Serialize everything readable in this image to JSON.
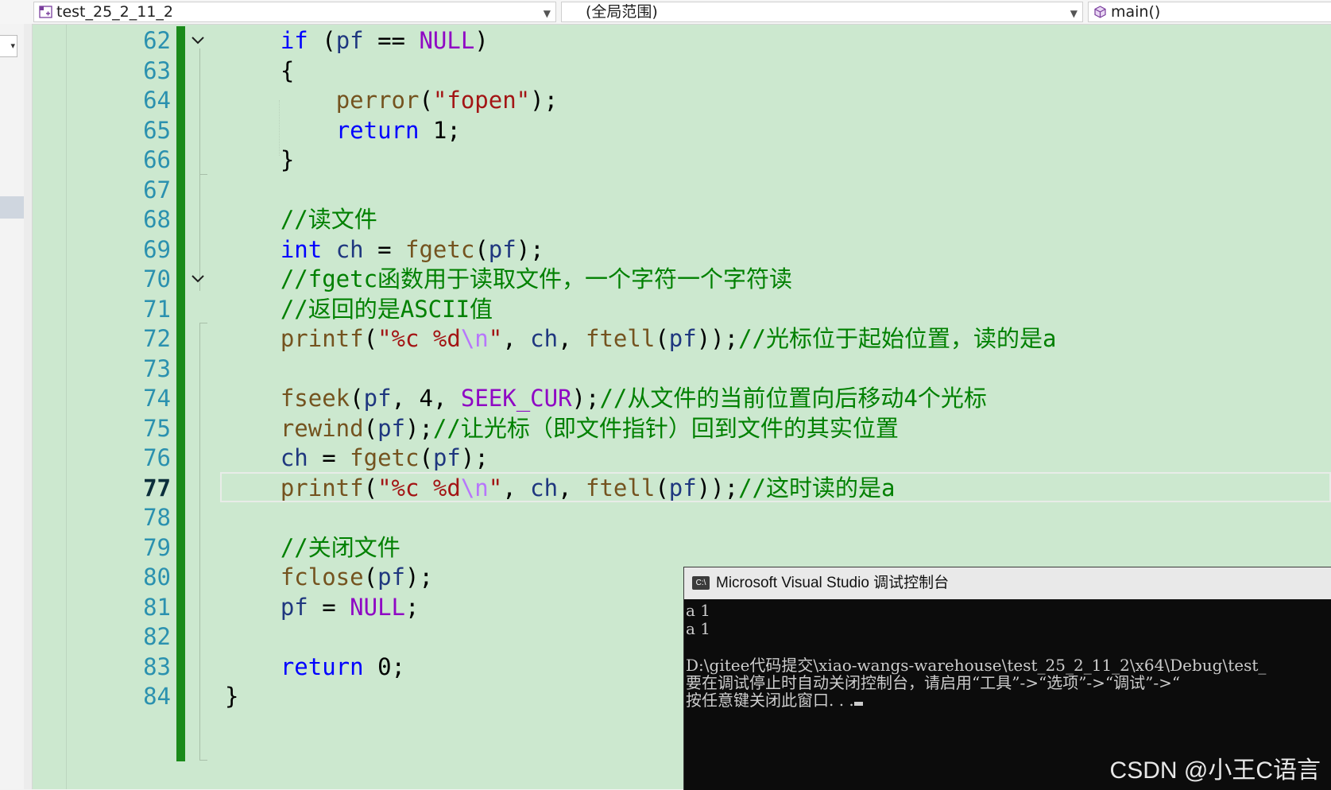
{
  "navbar": {
    "project": "test_25_2_11_2",
    "scope": "(全局范围)",
    "function": "main()"
  },
  "editor": {
    "current_line": 77,
    "lines": [
      {
        "n": "62",
        "tokens": [
          {
            "t": "    "
          },
          {
            "t": "if",
            "c": "kw"
          },
          {
            "t": " ("
          },
          {
            "t": "pf",
            "c": "var"
          },
          {
            "t": " == "
          },
          {
            "t": "NULL",
            "c": "mac"
          },
          {
            "t": ")"
          }
        ]
      },
      {
        "n": "63",
        "tokens": [
          {
            "t": "    {"
          }
        ]
      },
      {
        "n": "64",
        "tokens": [
          {
            "t": "        "
          },
          {
            "t": "perror",
            "c": "fn"
          },
          {
            "t": "("
          },
          {
            "t": "\"fopen\"",
            "c": "str"
          },
          {
            "t": ");"
          }
        ]
      },
      {
        "n": "65",
        "tokens": [
          {
            "t": "        "
          },
          {
            "t": "return",
            "c": "kw"
          },
          {
            "t": " "
          },
          {
            "t": "1",
            "c": "num"
          },
          {
            "t": ";"
          }
        ]
      },
      {
        "n": "66",
        "tokens": [
          {
            "t": "    }"
          }
        ]
      },
      {
        "n": "67",
        "tokens": []
      },
      {
        "n": "68",
        "tokens": [
          {
            "t": "    "
          },
          {
            "t": "//读文件",
            "c": "cm"
          }
        ]
      },
      {
        "n": "69",
        "tokens": [
          {
            "t": "    "
          },
          {
            "t": "int",
            "c": "kw"
          },
          {
            "t": " "
          },
          {
            "t": "ch",
            "c": "var"
          },
          {
            "t": " = "
          },
          {
            "t": "fgetc",
            "c": "fn"
          },
          {
            "t": "("
          },
          {
            "t": "pf",
            "c": "var"
          },
          {
            "t": ");"
          }
        ]
      },
      {
        "n": "70",
        "tokens": [
          {
            "t": "    "
          },
          {
            "t": "//fgetc函数用于读取文件，一个字符一个字符读",
            "c": "cm"
          }
        ]
      },
      {
        "n": "71",
        "tokens": [
          {
            "t": "    "
          },
          {
            "t": "//返回的是ASCII值",
            "c": "cm"
          }
        ]
      },
      {
        "n": "72",
        "tokens": [
          {
            "t": "    "
          },
          {
            "t": "printf",
            "c": "fn"
          },
          {
            "t": "("
          },
          {
            "t": "\"%c %d",
            "c": "str"
          },
          {
            "t": "\\n",
            "c": "esc"
          },
          {
            "t": "\"",
            "c": "str"
          },
          {
            "t": ", "
          },
          {
            "t": "ch",
            "c": "var"
          },
          {
            "t": ", "
          },
          {
            "t": "ftell",
            "c": "fn"
          },
          {
            "t": "("
          },
          {
            "t": "pf",
            "c": "var"
          },
          {
            "t": "));"
          },
          {
            "t": "//光标位于起始位置，读的是a",
            "c": "cm"
          }
        ]
      },
      {
        "n": "73",
        "tokens": []
      },
      {
        "n": "74",
        "tokens": [
          {
            "t": "    "
          },
          {
            "t": "fseek",
            "c": "fn"
          },
          {
            "t": "("
          },
          {
            "t": "pf",
            "c": "var"
          },
          {
            "t": ", "
          },
          {
            "t": "4",
            "c": "num"
          },
          {
            "t": ", "
          },
          {
            "t": "SEEK_CUR",
            "c": "mac"
          },
          {
            "t": ");"
          },
          {
            "t": "//从文件的当前位置向后移动4个光标",
            "c": "cm"
          }
        ]
      },
      {
        "n": "75",
        "tokens": [
          {
            "t": "    "
          },
          {
            "t": "rewind",
            "c": "fn"
          },
          {
            "t": "("
          },
          {
            "t": "pf",
            "c": "var"
          },
          {
            "t": ");"
          },
          {
            "t": "//让光标（即文件指针）回到文件的其实位置",
            "c": "cm"
          }
        ]
      },
      {
        "n": "76",
        "tokens": [
          {
            "t": "    "
          },
          {
            "t": "ch",
            "c": "var"
          },
          {
            "t": " = "
          },
          {
            "t": "fgetc",
            "c": "fn"
          },
          {
            "t": "("
          },
          {
            "t": "pf",
            "c": "var"
          },
          {
            "t": ");"
          }
        ]
      },
      {
        "n": "77",
        "tokens": [
          {
            "t": "    "
          },
          {
            "t": "printf",
            "c": "fn"
          },
          {
            "t": "("
          },
          {
            "t": "\"%c %d",
            "c": "str"
          },
          {
            "t": "\\n",
            "c": "esc"
          },
          {
            "t": "\"",
            "c": "str"
          },
          {
            "t": ", "
          },
          {
            "t": "ch",
            "c": "var"
          },
          {
            "t": ", "
          },
          {
            "t": "ftell",
            "c": "fn"
          },
          {
            "t": "("
          },
          {
            "t": "pf",
            "c": "var"
          },
          {
            "t": "));"
          },
          {
            "t": "//这时读的是a",
            "c": "cm"
          }
        ]
      },
      {
        "n": "78",
        "tokens": []
      },
      {
        "n": "79",
        "tokens": [
          {
            "t": "    "
          },
          {
            "t": "//关闭文件",
            "c": "cm"
          }
        ]
      },
      {
        "n": "80",
        "tokens": [
          {
            "t": "    "
          },
          {
            "t": "fclose",
            "c": "fn"
          },
          {
            "t": "("
          },
          {
            "t": "pf",
            "c": "var"
          },
          {
            "t": ");"
          }
        ]
      },
      {
        "n": "81",
        "tokens": [
          {
            "t": "    "
          },
          {
            "t": "pf",
            "c": "var"
          },
          {
            "t": " = "
          },
          {
            "t": "NULL",
            "c": "mac"
          },
          {
            "t": ";"
          }
        ]
      },
      {
        "n": "82",
        "tokens": []
      },
      {
        "n": "83",
        "tokens": [
          {
            "t": "    "
          },
          {
            "t": "return",
            "c": "kw"
          },
          {
            "t": " "
          },
          {
            "t": "0",
            "c": "num"
          },
          {
            "t": ";"
          }
        ]
      },
      {
        "n": "84",
        "tokens": [
          {
            "t": "}"
          }
        ]
      }
    ]
  },
  "console": {
    "icon_label": "C:\\",
    "title": "Microsoft Visual Studio 调试控制台",
    "lines": [
      "a 1",
      "a 1",
      "",
      "D:\\gitee代码提交\\xiao-wangs-warehouse\\test_25_2_11_2\\x64\\Debug\\test_",
      "要在调试停止时自动关闭控制台，请启用“工具”->“选项”->“调试”->“",
      "按任意键关闭此窗口. . ."
    ],
    "watermark": "CSDN @小王C语言"
  },
  "colors": {
    "editor_bg": "#cce8cf",
    "change_bar": "#1a8a1a",
    "console_bg": "#0c0c0c"
  }
}
